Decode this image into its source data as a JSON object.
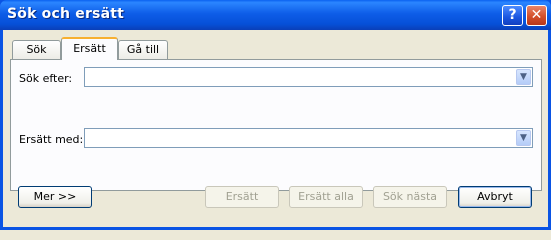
{
  "window": {
    "title": "Sök och ersätt",
    "help_label": "?",
    "close_label": "✕"
  },
  "tabs": [
    {
      "label": "Sök",
      "active": false
    },
    {
      "label": "Ersätt",
      "active": true
    },
    {
      "label": "Gå till",
      "active": false
    }
  ],
  "fields": {
    "find_label": "Sök efter:",
    "find_value": "",
    "replace_label": "Ersätt med:",
    "replace_value": ""
  },
  "buttons": {
    "more": "Mer >>",
    "replace": "Ersätt",
    "replace_all": "Ersätt alla",
    "find_next": "Sök nästa",
    "cancel": "Avbryt"
  },
  "icons": {
    "dropdown": "chevron-down-icon"
  },
  "colors": {
    "titlebar": "#0a54e4",
    "dialog_bg": "#ece9d8",
    "active_tab_accent": "#f7b031"
  }
}
